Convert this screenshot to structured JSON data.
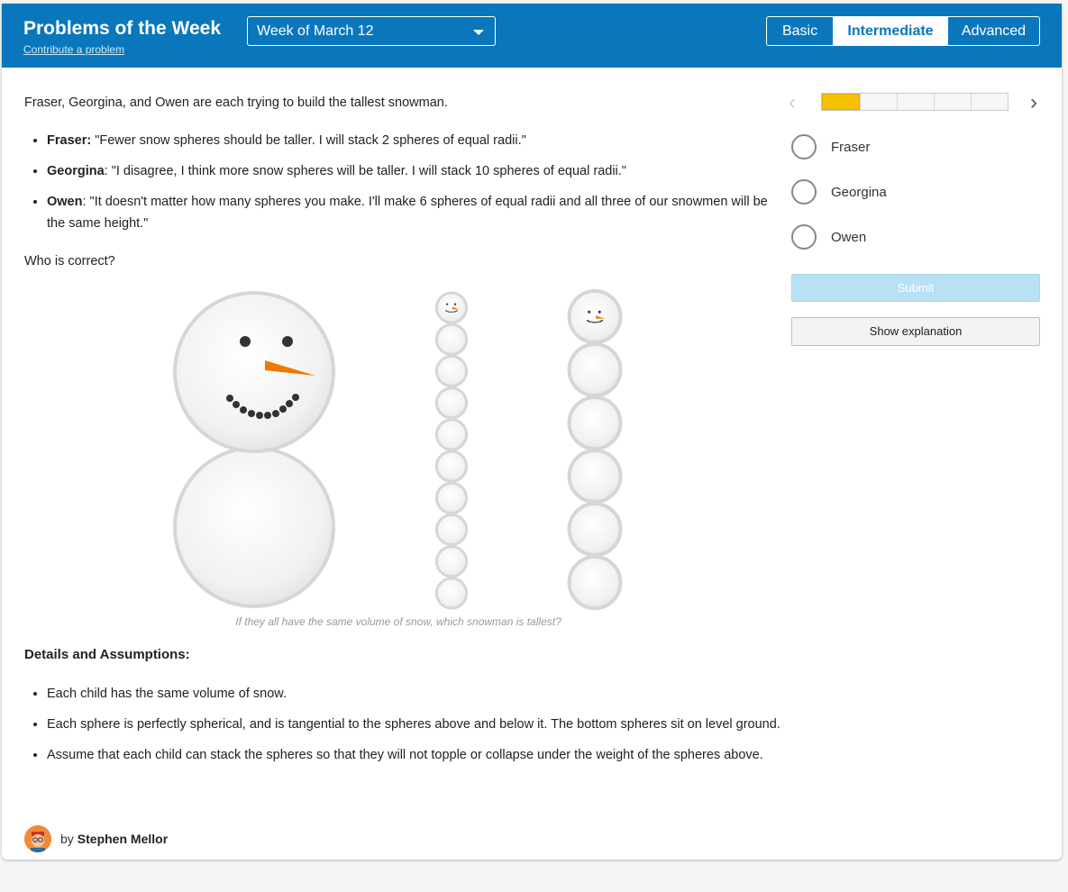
{
  "header": {
    "title": "Problems of the Week",
    "contribute_link": "Contribute a problem",
    "week_select": "Week of March 12",
    "levels": [
      "Basic",
      "Intermediate",
      "Advanced"
    ],
    "active_level": "Intermediate"
  },
  "problem": {
    "intro": "Fraser, Georgina, and Owen are each trying to build the tallest snowman.",
    "claims": [
      {
        "name": "Fraser:",
        "quote": " \"Fewer snow spheres should be taller. I will stack 2 spheres of equal radii.\""
      },
      {
        "name": "Georgina",
        "quote": ": \"I disagree, I think more snow spheres will be taller. I will stack 10 spheres of equal radii.\""
      },
      {
        "name": "Owen",
        "quote": ": \"It doesn't matter how many spheres you make. I'll make 6 spheres of equal radii and all three of our snowmen will be the same height.\""
      }
    ],
    "question": "Who is correct?",
    "image_caption": "If they all have the same volume of snow, which snowman is tallest?",
    "details_heading": "Details and Assumptions:",
    "details": [
      "Each child has the same volume of snow.",
      "Each sphere is perfectly spherical, and is tangential to the spheres above and below it. The bottom spheres sit on level ground.",
      "Assume that each child can stack the spheres so that they will not topple or collapse under the weight of the spheres above."
    ]
  },
  "author": {
    "by": "by",
    "name": "Stephen Mellor"
  },
  "sidebar": {
    "progress": {
      "completed": 1,
      "total": 5
    },
    "options": [
      "Fraser",
      "Georgina",
      "Owen"
    ],
    "submit_label": "Submit",
    "explanation_label": "Show explanation"
  },
  "icons": {
    "prev": "chevron-left-icon",
    "next": "chevron-right-icon",
    "dropdown": "caret-down-icon"
  },
  "colors": {
    "header": "#0a77bd",
    "progress": "#f6c100",
    "submit": "#b9e1f6",
    "carrot": "#f07800"
  }
}
